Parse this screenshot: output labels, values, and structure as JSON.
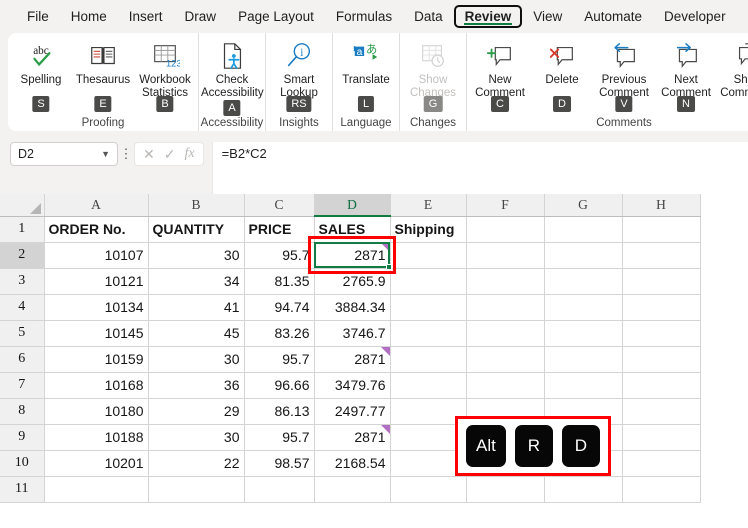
{
  "ribbon": {
    "tabs": [
      {
        "label": "File",
        "active": false
      },
      {
        "label": "Home",
        "active": false
      },
      {
        "label": "Insert",
        "active": false
      },
      {
        "label": "Draw",
        "active": false
      },
      {
        "label": "Page Layout",
        "active": false
      },
      {
        "label": "Formulas",
        "active": false
      },
      {
        "label": "Data",
        "active": false
      },
      {
        "label": "Review",
        "active": true
      },
      {
        "label": "View",
        "active": false
      },
      {
        "label": "Automate",
        "active": false
      },
      {
        "label": "Developer",
        "active": false
      },
      {
        "label": "Help",
        "active": false
      }
    ],
    "groups": [
      {
        "name": "Proofing",
        "label": "Proofing",
        "buttons": [
          {
            "caption": "Spelling",
            "icon": "spelling-icon",
            "keytip": "S",
            "disabled": false
          },
          {
            "caption": "Thesaurus",
            "icon": "thesaurus-icon",
            "keytip": "E",
            "disabled": false
          },
          {
            "caption": "Workbook Statistics",
            "icon": "workbook-statistics-icon",
            "keytip": "B",
            "disabled": false
          }
        ]
      },
      {
        "name": "Accessibility",
        "label": "Accessibility",
        "buttons": [
          {
            "caption": "Check Accessibility ~",
            "icon": "check-accessibility-icon",
            "keytip": "A",
            "disabled": false
          }
        ]
      },
      {
        "name": "Insights",
        "label": "Insights",
        "buttons": [
          {
            "caption": "Smart Lookup",
            "icon": "smart-lookup-icon",
            "keytip": "RS",
            "disabled": false
          }
        ]
      },
      {
        "name": "Language",
        "label": "Language",
        "buttons": [
          {
            "caption": "Translate",
            "icon": "translate-icon",
            "keytip": "L",
            "disabled": false
          }
        ]
      },
      {
        "name": "Changes",
        "label": "Changes",
        "buttons": [
          {
            "caption": "Show Changes",
            "icon": "show-changes-icon",
            "keytip": "G",
            "disabled": true
          }
        ]
      },
      {
        "name": "Comments",
        "label": "Comments",
        "buttons": [
          {
            "caption": "New Comment",
            "icon": "new-comment-icon",
            "keytip": "C",
            "disabled": false
          },
          {
            "caption": "Delete",
            "icon": "delete-comment-icon",
            "keytip": "D",
            "disabled": false
          },
          {
            "caption": "Previous Comment",
            "icon": "previous-comment-icon",
            "keytip": "V",
            "disabled": false
          },
          {
            "caption": "Next Comment",
            "icon": "next-comment-icon",
            "keytip": "N",
            "disabled": false
          },
          {
            "caption": "Show Comments",
            "icon": "show-comments-icon",
            "keytip": "",
            "disabled": false
          }
        ]
      }
    ]
  },
  "formula_bar": {
    "name_box_value": "D2",
    "cancel_icon": "cancel-icon",
    "confirm_icon": "confirm-icon",
    "function_icon": "insert-function-icon",
    "formula": "=B2*C2"
  },
  "sheet": {
    "columns": [
      "A",
      "B",
      "C",
      "D",
      "E",
      "F",
      "G",
      "H"
    ],
    "selected_column": "D",
    "selected_row": "2",
    "selected_cell": "D2",
    "row_numbers": [
      "1",
      "2",
      "3",
      "4",
      "5",
      "6",
      "7",
      "8",
      "9",
      "10",
      "11"
    ],
    "rows": [
      {
        "num": "1",
        "cells": [
          "ORDER No.",
          "QUANTITY",
          "PRICE",
          "SALES",
          "Shipping",
          "",
          "",
          ""
        ],
        "header": true
      },
      {
        "num": "2",
        "cells": [
          "10107",
          "30",
          "95.7",
          "2871",
          "",
          "",
          "",
          ""
        ],
        "comment_col": 3
      },
      {
        "num": "3",
        "cells": [
          "10121",
          "34",
          "81.35",
          "2765.9",
          "",
          "",
          "",
          ""
        ],
        "comment_col": -1
      },
      {
        "num": "4",
        "cells": [
          "10134",
          "41",
          "94.74",
          "3884.34",
          "",
          "",
          "",
          ""
        ],
        "comment_col": -1
      },
      {
        "num": "5",
        "cells": [
          "10145",
          "45",
          "83.26",
          "3746.7",
          "",
          "",
          "",
          ""
        ],
        "comment_col": -1
      },
      {
        "num": "6",
        "cells": [
          "10159",
          "30",
          "95.7",
          "2871",
          "",
          "",
          "",
          ""
        ],
        "comment_col": 3
      },
      {
        "num": "7",
        "cells": [
          "10168",
          "36",
          "96.66",
          "3479.76",
          "",
          "",
          "",
          ""
        ],
        "comment_col": -1
      },
      {
        "num": "8",
        "cells": [
          "10180",
          "29",
          "86.13",
          "2497.77",
          "",
          "",
          "",
          ""
        ],
        "comment_col": -1
      },
      {
        "num": "9",
        "cells": [
          "10188",
          "30",
          "95.7",
          "2871",
          "",
          "",
          "",
          ""
        ],
        "comment_col": 3
      },
      {
        "num": "10",
        "cells": [
          "10201",
          "22",
          "98.57",
          "2168.54",
          "",
          "",
          "",
          ""
        ],
        "comment_col": -1
      },
      {
        "num": "11",
        "cells": [
          "",
          "",
          "",
          "",
          "",
          "",
          "",
          ""
        ],
        "comment_col": -1
      }
    ]
  },
  "key_overlay": {
    "keys": [
      "Alt",
      "R",
      "D"
    ],
    "border_color": "#ff0000"
  },
  "colors": {
    "accent_green": "#107c41",
    "annotation_red": "#ff0000",
    "comment_purple": "#b36fc4",
    "keytip_bg": "#4a4a48"
  }
}
